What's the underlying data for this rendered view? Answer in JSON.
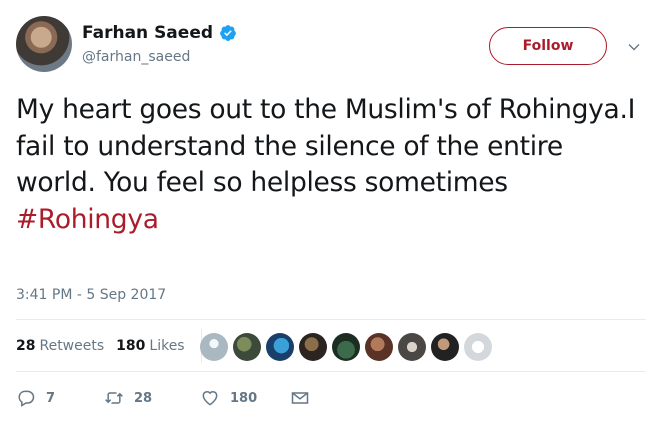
{
  "user": {
    "display_name": "Farhan Saeed",
    "handle": "@farhan_saeed",
    "verified": true,
    "follow_label": "Follow"
  },
  "tweet": {
    "text": "My heart goes out to the Muslim's of Rohingya.I fail to understand the silence of the entire world. You feel so helpless sometimes",
    "hashtag": "#Rohingya",
    "timestamp": "3:41 PM - 5 Sep 2017"
  },
  "stats": {
    "retweets_count": "28",
    "retweets_label": "Retweets",
    "likes_count": "180",
    "likes_label": "Likes"
  },
  "actions": {
    "reply_count": "7",
    "retweet_count": "28",
    "like_count": "180"
  },
  "colors": {
    "accent": "#ab1c2b",
    "verified": "#1da1f2",
    "muted": "#657786",
    "text": "#14171a"
  },
  "icons": {
    "verified": "verified-badge-icon",
    "menu": "chevron-down-icon",
    "reply": "reply-icon",
    "retweet": "retweet-icon",
    "like": "heart-icon",
    "dm": "envelope-icon"
  }
}
